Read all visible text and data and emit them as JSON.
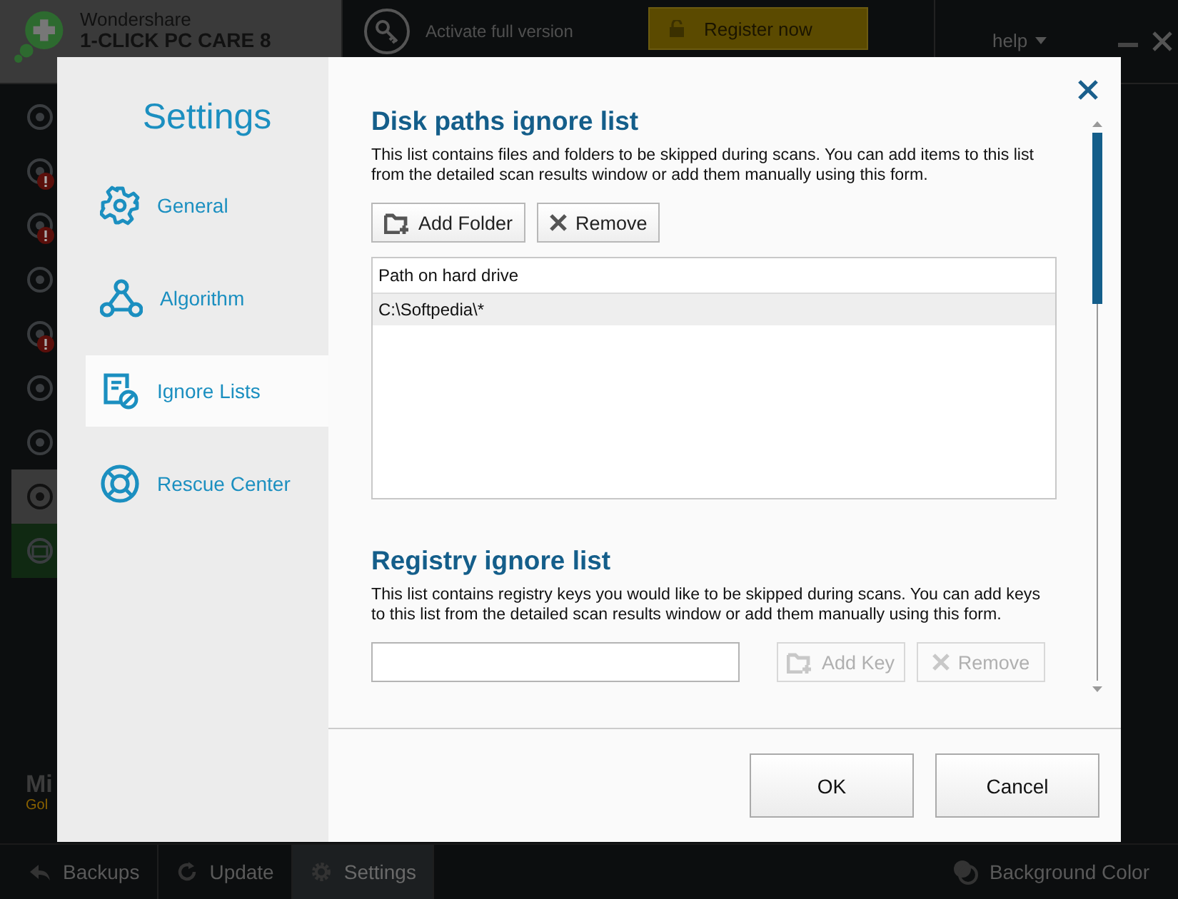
{
  "app": {
    "brand": "Wondershare",
    "product": "1-CLICK PC CARE 8",
    "activate": "Activate full version",
    "register": "Register now",
    "help": "help"
  },
  "rail": [
    {
      "kind": "tool",
      "alert": false,
      "selected": false
    },
    {
      "kind": "tool",
      "alert": true,
      "selected": false
    },
    {
      "kind": "tool",
      "alert": true,
      "selected": false
    },
    {
      "kind": "tool",
      "alert": false,
      "selected": false
    },
    {
      "kind": "tool",
      "alert": true,
      "selected": false
    },
    {
      "kind": "tool",
      "alert": false,
      "selected": false
    },
    {
      "kind": "tool",
      "alert": false,
      "selected": false
    },
    {
      "kind": "tool",
      "alert": false,
      "selected": true
    },
    {
      "kind": "promo",
      "alert": false,
      "selected": false
    }
  ],
  "promo_text": [
    "Mi",
    "Gol"
  ],
  "bottom_tabs": [
    {
      "label": "Backups",
      "selected": false
    },
    {
      "label": "Update",
      "selected": false
    },
    {
      "label": "Settings",
      "selected": true
    }
  ],
  "background_color": "Background Color",
  "dialog": {
    "title": "Settings",
    "nav": [
      {
        "label": "General",
        "selected": false
      },
      {
        "label": "Algorithm",
        "selected": false
      },
      {
        "label": "Ignore Lists",
        "selected": true
      },
      {
        "label": "Rescue Center",
        "selected": false
      }
    ],
    "disk": {
      "heading": "Disk paths ignore list",
      "description": "This list contains files and folders to be skipped during scans. You can add items to this list from the detailed scan results window or add them manually using this form.",
      "buttons": [
        {
          "label": "Add Folder",
          "disabled": false
        },
        {
          "label": "Remove",
          "disabled": false
        }
      ],
      "column": "Path on hard drive",
      "rows": [
        {
          "path": "C:\\Softpedia\\*",
          "selected": true
        }
      ]
    },
    "registry": {
      "heading": "Registry ignore list",
      "description": "This list contains registry keys you would like to be skipped during scans. You can add keys to this list from the detailed scan results window or add them manually using this form.",
      "buttons": [
        {
          "label": "Add Key",
          "disabled": true
        },
        {
          "label": "Remove",
          "disabled": true
        }
      ]
    },
    "footer": [
      "OK",
      "Cancel"
    ]
  }
}
